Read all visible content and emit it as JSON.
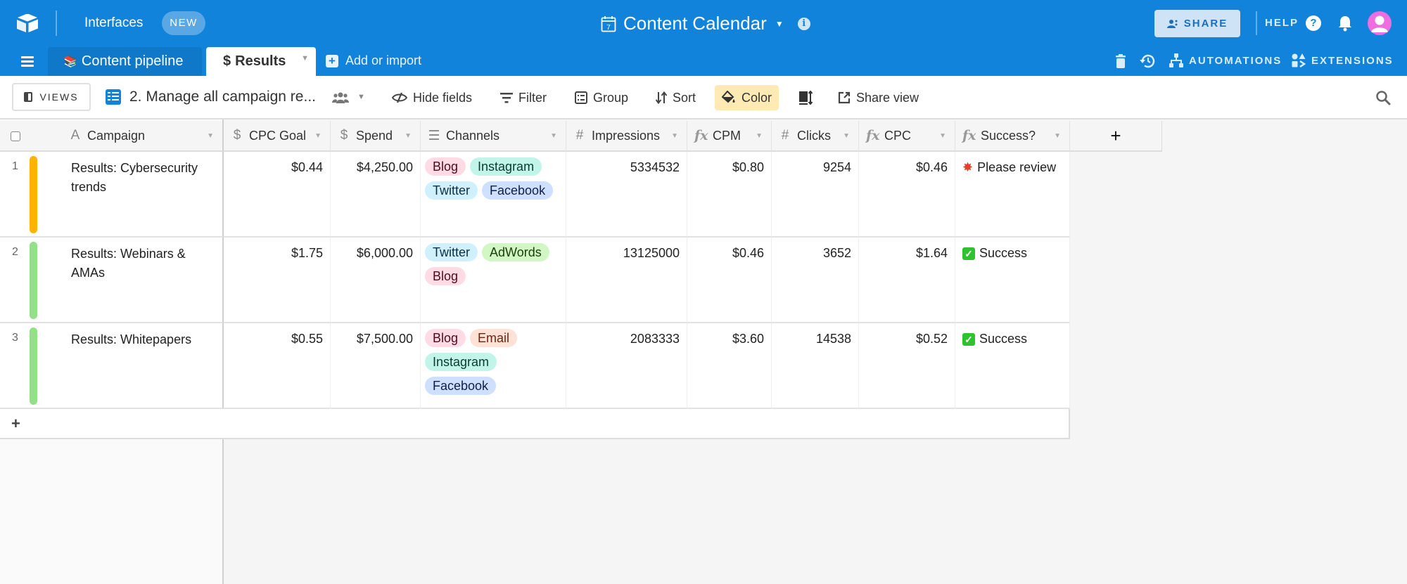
{
  "topbar": {
    "interfaces_label": "Interfaces",
    "new_badge": "NEW",
    "base_title": "Content Calendar",
    "share_label": "SHARE",
    "help_label": "HELP",
    "colors": {
      "brand": "#1283da",
      "avatar": "#ee6de0"
    }
  },
  "tabs": [
    {
      "label": "Content pipeline",
      "icon": "books-emoji-icon",
      "active": false
    },
    {
      "label": "Results",
      "icon": "dollar-icon",
      "active": true
    }
  ],
  "add_import_label": "Add or import",
  "tab_actions": {
    "automations_label": "AUTOMATIONS",
    "extensions_label": "EXTENSIONS"
  },
  "toolbar": {
    "views_label": "VIEWS",
    "view_name": "2. Manage all campaign re...",
    "hide_fields": "Hide fields",
    "filter": "Filter",
    "group": "Group",
    "sort": "Sort",
    "color": "Color",
    "share_view": "Share view",
    "color_active_bg": "#ffeab6"
  },
  "columns": [
    {
      "name": "Campaign",
      "type": "text"
    },
    {
      "name": "CPC Goal",
      "type": "currency"
    },
    {
      "name": "Spend",
      "type": "currency"
    },
    {
      "name": "Channels",
      "type": "multiselect"
    },
    {
      "name": "Impressions",
      "type": "number"
    },
    {
      "name": "CPM",
      "type": "formula"
    },
    {
      "name": "Clicks",
      "type": "number"
    },
    {
      "name": "CPC",
      "type": "formula"
    },
    {
      "name": "Success?",
      "type": "formula"
    }
  ],
  "channel_colors": {
    "Blog": {
      "bg": "#ffdce5",
      "fg": "#4c0c1c"
    },
    "Instagram": {
      "bg": "#c2f5e9",
      "fg": "#0b3b30"
    },
    "Twitter": {
      "bg": "#d0f0fd",
      "fg": "#0b3045"
    },
    "Facebook": {
      "bg": "#cfdfff",
      "fg": "#102046"
    },
    "AdWords": {
      "bg": "#d1f7c4",
      "fg": "#1d3c10"
    },
    "Email": {
      "bg": "#fee2d5",
      "fg": "#6b2613"
    }
  },
  "rows": [
    {
      "num": "1",
      "color": "#fcb400",
      "campaign": "Results: Cybersecurity trends",
      "cpc_goal": "$0.44",
      "spend": "$4,250.00",
      "channels": [
        "Blog",
        "Instagram",
        "Twitter",
        "Facebook"
      ],
      "impressions": "5334532",
      "cpm": "$0.80",
      "clicks": "9254",
      "cpc": "$0.46",
      "success": "Please review",
      "success_icon": "collision"
    },
    {
      "num": "2",
      "color": "#93e088",
      "campaign": "Results: Webinars & AMAs",
      "cpc_goal": "$1.75",
      "spend": "$6,000.00",
      "channels": [
        "Twitter",
        "AdWords",
        "Blog"
      ],
      "impressions": "13125000",
      "cpm": "$0.46",
      "clicks": "3652",
      "cpc": "$1.64",
      "success": "Success",
      "success_icon": "check"
    },
    {
      "num": "3",
      "color": "#93e088",
      "campaign": "Results: Whitepapers",
      "cpc_goal": "$0.55",
      "spend": "$7,500.00",
      "channels": [
        "Blog",
        "Email",
        "Instagram",
        "Facebook"
      ],
      "impressions": "2083333",
      "cpm": "$3.60",
      "clicks": "14538",
      "cpc": "$0.52",
      "success": "Success",
      "success_icon": "check"
    }
  ],
  "add_row_label": "+",
  "add_column_label": "+"
}
